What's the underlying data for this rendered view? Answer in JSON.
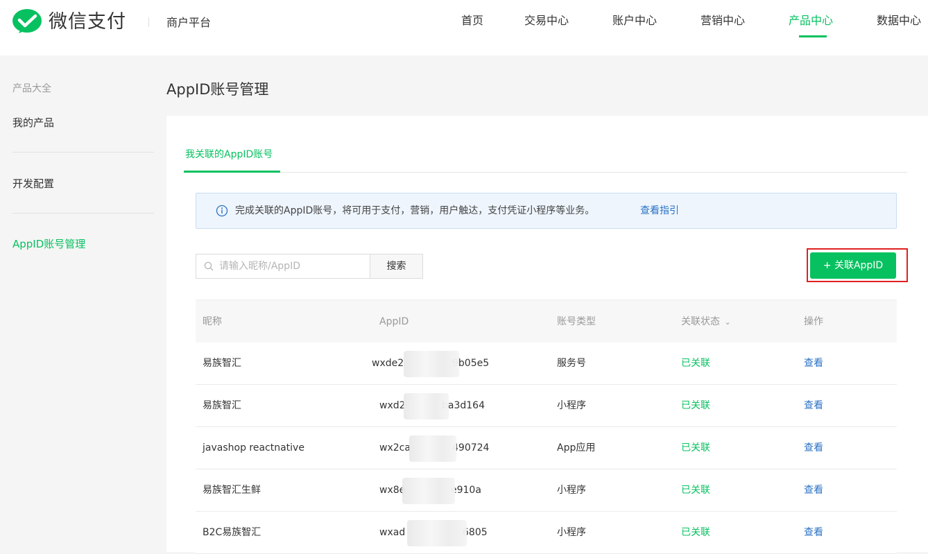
{
  "header": {
    "brand": "微信支付",
    "subtitle": "商户平台",
    "nav": [
      "首页",
      "交易中心",
      "账户中心",
      "营销中心",
      "产品中心",
      "数据中心"
    ],
    "active_nav": "产品中心"
  },
  "sidebar": {
    "group_title": "产品大全",
    "items": [
      "我的产品",
      "开发配置",
      "AppID账号管理"
    ],
    "active_item": "AppID账号管理"
  },
  "page": {
    "title": "AppID账号管理",
    "tab": "我关联的AppID账号",
    "notice": "完成关联的AppID账号，将可用于支付，营销，用户触达，支付凭证小程序等业务。",
    "notice_link": "查看指引"
  },
  "search": {
    "placeholder": "请输入昵称/AppID",
    "button": "搜索"
  },
  "add_button": "+ 关联AppID",
  "table": {
    "columns": [
      "昵称",
      "AppID",
      "账号类型",
      "关联状态",
      "操作"
    ],
    "status_column_suffix": "⌄",
    "rows": [
      {
        "nickname": "易族智汇",
        "appid_prefix": "wxde2",
        "appid_suffix": "9b05e5",
        "type": "服务号",
        "status": "已关联",
        "action": "查看"
      },
      {
        "nickname": "易族智汇",
        "appid_prefix": "wxd2",
        "appid_suffix": "ba3d164",
        "type": "小程序",
        "status": "已关联",
        "action": "查看"
      },
      {
        "nickname": "javashop reactnative",
        "appid_prefix": "wx2ca",
        "appid_suffix": "490724",
        "type": "App应用",
        "status": "已关联",
        "action": "查看"
      },
      {
        "nickname": "易族智汇生鲜",
        "appid_prefix": "wx8e",
        "appid_suffix": "e910a",
        "type": "小程序",
        "status": "已关联",
        "action": "查看"
      },
      {
        "nickname": "B2C易族智汇",
        "appid_prefix": "wxad",
        "appid_suffix": "6805",
        "type": "小程序",
        "status": "已关联",
        "action": "查看"
      }
    ]
  },
  "colors": {
    "accent": "#07c160",
    "link": "#2b72c4",
    "highlight_frame": "#e02020"
  }
}
